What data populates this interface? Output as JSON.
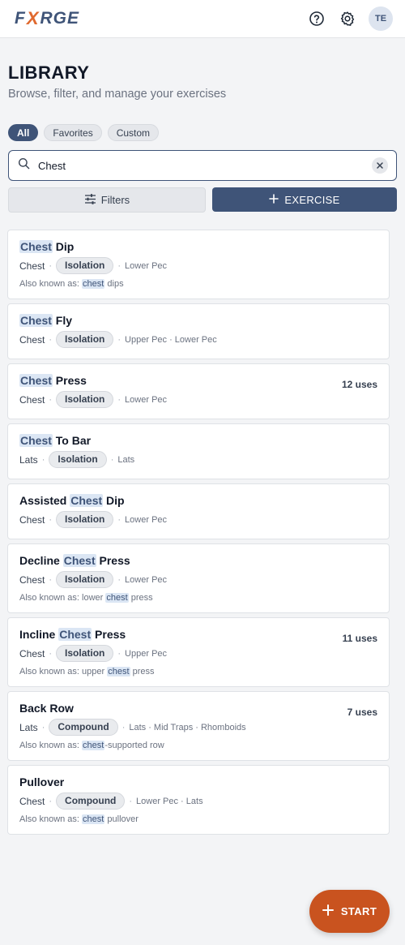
{
  "header": {
    "logo_left": "F",
    "logo_x": "X",
    "logo_right": "RGE",
    "avatar_initials": "TE"
  },
  "page": {
    "title": "LIBRARY",
    "subtitle": "Browse, filter, and manage your exercises"
  },
  "segments": [
    "All",
    "Favorites",
    "Custom"
  ],
  "search": {
    "value": "Chest",
    "placeholder": ""
  },
  "actions": {
    "filters_label": "Filters",
    "exercise_label": "EXERCISE"
  },
  "exercises": [
    {
      "name_pre": "",
      "name_hl": "Chest",
      "name_post": " Dip",
      "primary": "Chest",
      "type": "Isolation",
      "muscles": "Lower Pec",
      "aka_label": "Also known as: ",
      "aka_pre": "",
      "aka_hl": "chest",
      "aka_post": " dips",
      "uses": ""
    },
    {
      "name_pre": "",
      "name_hl": "Chest",
      "name_post": " Fly",
      "primary": "Chest",
      "type": "Isolation",
      "muscles": "Upper Pec · Lower Pec",
      "aka_label": "",
      "aka_pre": "",
      "aka_hl": "",
      "aka_post": "",
      "uses": ""
    },
    {
      "name_pre": "",
      "name_hl": "Chest",
      "name_post": " Press",
      "primary": "Chest",
      "type": "Isolation",
      "muscles": "Lower Pec",
      "aka_label": "",
      "aka_pre": "",
      "aka_hl": "",
      "aka_post": "",
      "uses": "12 uses"
    },
    {
      "name_pre": "",
      "name_hl": "Chest",
      "name_post": " To Bar",
      "primary": "Lats",
      "type": "Isolation",
      "muscles": "Lats",
      "aka_label": "",
      "aka_pre": "",
      "aka_hl": "",
      "aka_post": "",
      "uses": ""
    },
    {
      "name_pre": "Assisted ",
      "name_hl": "Chest",
      "name_post": " Dip",
      "primary": "Chest",
      "type": "Isolation",
      "muscles": "Lower Pec",
      "aka_label": "",
      "aka_pre": "",
      "aka_hl": "",
      "aka_post": "",
      "uses": ""
    },
    {
      "name_pre": "Decline ",
      "name_hl": "Chest",
      "name_post": " Press",
      "primary": "Chest",
      "type": "Isolation",
      "muscles": "Lower Pec",
      "aka_label": "Also known as: ",
      "aka_pre": "lower ",
      "aka_hl": "chest",
      "aka_post": " press",
      "uses": ""
    },
    {
      "name_pre": "Incline ",
      "name_hl": "Chest",
      "name_post": " Press",
      "primary": "Chest",
      "type": "Isolation",
      "muscles": "Upper Pec",
      "aka_label": "Also known as: ",
      "aka_pre": "upper ",
      "aka_hl": "chest",
      "aka_post": " press",
      "uses": "11 uses"
    },
    {
      "name_pre": "Back Row",
      "name_hl": "",
      "name_post": "",
      "primary": "Lats",
      "type": "Compound",
      "muscles": "Lats · Mid Traps · Rhomboids",
      "aka_label": "Also known as: ",
      "aka_pre": "",
      "aka_hl": "chest",
      "aka_post": "-supported row",
      "uses": "7 uses"
    },
    {
      "name_pre": "Pullover",
      "name_hl": "",
      "name_post": "",
      "primary": "Chest",
      "type": "Compound",
      "muscles": "Lower Pec · Lats",
      "aka_label": "Also known as: ",
      "aka_pre": "",
      "aka_hl": "chest",
      "aka_post": " pullover",
      "uses": ""
    }
  ],
  "fab": {
    "label": "START"
  },
  "colors": {
    "brand": "#3f5478",
    "accent": "#c9531f",
    "highlight": "#dbe6f4"
  },
  "icons": [
    "help-icon",
    "gear-icon",
    "search-icon",
    "clear-icon",
    "filter-sliders-icon",
    "plus-icon"
  ]
}
